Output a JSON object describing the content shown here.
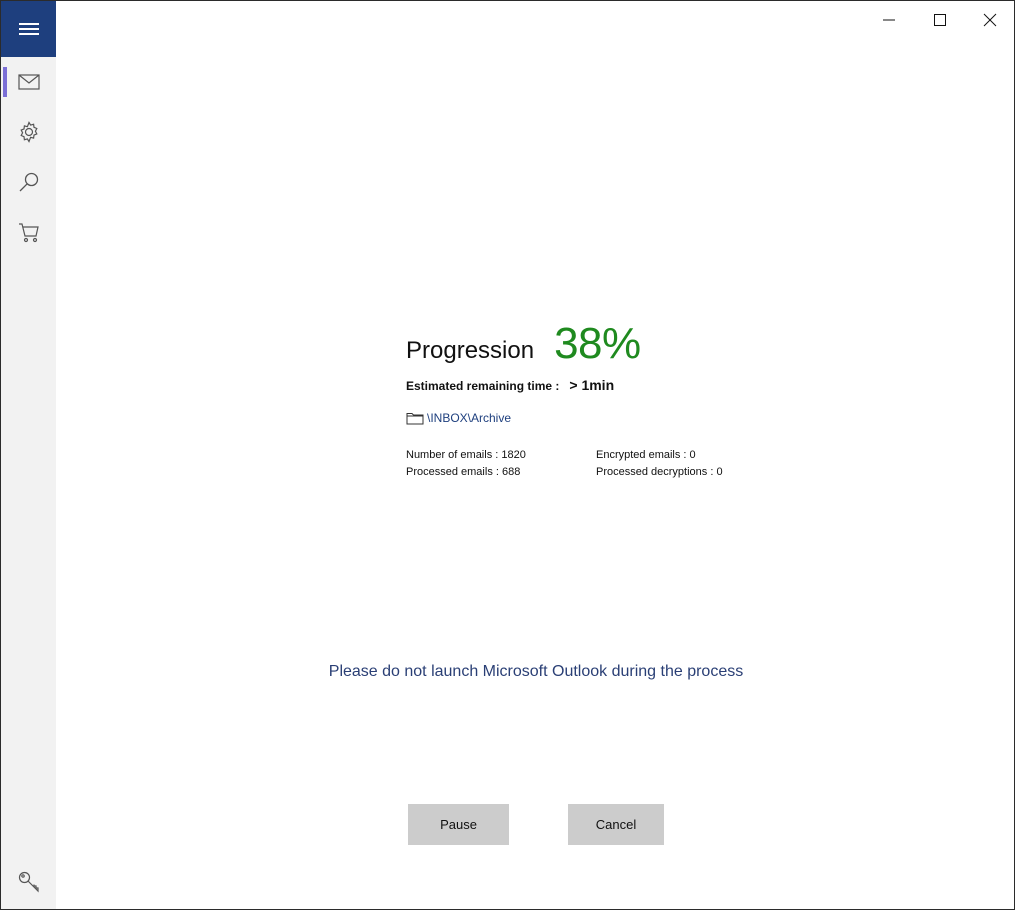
{
  "window": {
    "controls": [
      "minimize-icon",
      "maximize-icon",
      "close-icon"
    ]
  },
  "sidebar": {
    "items": [
      {
        "icon": "mail-icon",
        "active": true
      },
      {
        "icon": "gear-icon",
        "active": false
      },
      {
        "icon": "search-icon",
        "active": false
      },
      {
        "icon": "cart-icon",
        "active": false
      }
    ],
    "bottom_icon": "key-icon",
    "accent_color": "#1e3f7e",
    "active_indicator_color": "#7b6fd6"
  },
  "progress": {
    "label": "Progression",
    "value": "38%",
    "value_color": "#1f8a1f",
    "eta_label": "Estimated remaining time :",
    "eta_value": "> 1min",
    "folder_path": "\\INBOX\\Archive"
  },
  "stats": {
    "number_of_emails": "Number of emails : 1820",
    "processed_emails": "Processed emails : 688",
    "encrypted_emails": "Encrypted emails : 0",
    "processed_decryptions": "Processed decryptions : 0"
  },
  "warning": "Please do not launch Microsoft Outlook during the process",
  "buttons": {
    "pause": "Pause",
    "cancel": "Cancel"
  }
}
